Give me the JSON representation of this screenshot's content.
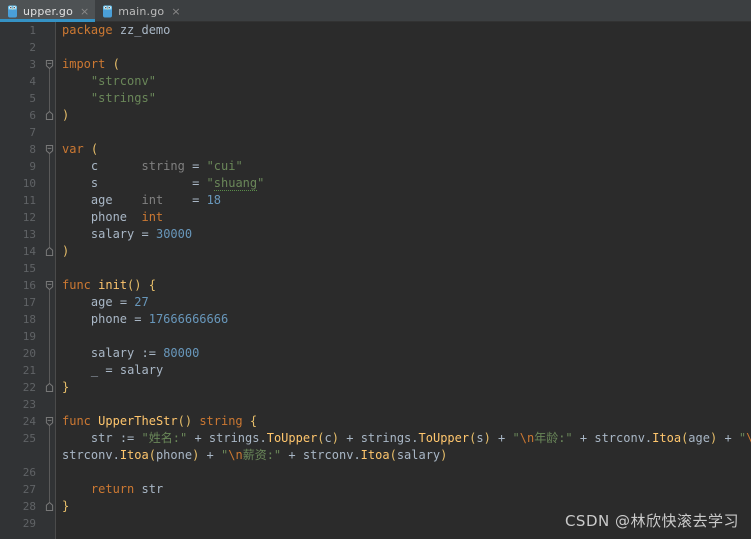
{
  "window": {
    "title": "upper.go",
    "editor_background": "#2b2b2b",
    "gutter_background": "#313335",
    "tabbar_background": "#3c3f41",
    "accent_color": "#3592c4"
  },
  "tabbar": {
    "tabs": [
      {
        "label": "upper.go",
        "icon": "go-gopher-icon",
        "close_glyph": "×",
        "active": true
      },
      {
        "label": "main.go",
        "icon": "go-gopher-icon",
        "close_glyph": "×",
        "active": false
      }
    ]
  },
  "editor": {
    "language": "go",
    "line_numbers": [
      "1",
      "2",
      "3",
      "4",
      "5",
      "6",
      "7",
      "8",
      "9",
      "10",
      "11",
      "12",
      "13",
      "14",
      "15",
      "16",
      "17",
      "18",
      "19",
      "20",
      "21",
      "22",
      "23",
      "24",
      "25",
      "26",
      "27",
      "28",
      "29"
    ],
    "code_lines": [
      {
        "n": 1,
        "text": "package zz_demo"
      },
      {
        "n": 2,
        "text": ""
      },
      {
        "n": 3,
        "text": "import ("
      },
      {
        "n": 4,
        "text": "    \"strconv\""
      },
      {
        "n": 5,
        "text": "    \"strings\""
      },
      {
        "n": 6,
        "text": ")"
      },
      {
        "n": 7,
        "text": ""
      },
      {
        "n": 8,
        "text": "var ("
      },
      {
        "n": 9,
        "text": "    c      string = \"cui\""
      },
      {
        "n": 10,
        "text": "    s             = \"shuang\""
      },
      {
        "n": 11,
        "text": "    age    int    = 18"
      },
      {
        "n": 12,
        "text": "    phone  int"
      },
      {
        "n": 13,
        "text": "    salary = 30000"
      },
      {
        "n": 14,
        "text": ")"
      },
      {
        "n": 15,
        "text": ""
      },
      {
        "n": 16,
        "text": "func init() {"
      },
      {
        "n": 17,
        "text": "    age = 27"
      },
      {
        "n": 18,
        "text": "    phone = 17666666666"
      },
      {
        "n": 19,
        "text": ""
      },
      {
        "n": 20,
        "text": "    salary := 80000"
      },
      {
        "n": 21,
        "text": "    _ = salary"
      },
      {
        "n": 22,
        "text": "}"
      },
      {
        "n": 23,
        "text": ""
      },
      {
        "n": 24,
        "text": "func UpperTheStr() string {"
      },
      {
        "n": 25,
        "text": "    str := \"姓名:\" + strings.ToUpper(c) + strings.ToUpper(s) + \"\\n年龄:\" + strconv.Itoa(age) + \"\\n手机号:\" + strconv.Itoa(phone) + \"\\n薪资:\" + strconv.Itoa(salary)"
      },
      {
        "n": 26,
        "text": ""
      },
      {
        "n": 27,
        "text": "    return str"
      },
      {
        "n": 28,
        "text": "}"
      },
      {
        "n": 29,
        "text": ""
      }
    ],
    "fold_markers": [
      {
        "line": 3,
        "state": "expanded"
      },
      {
        "line": 6,
        "state": "end"
      },
      {
        "line": 8,
        "state": "expanded"
      },
      {
        "line": 14,
        "state": "end"
      },
      {
        "line": 16,
        "state": "expanded"
      },
      {
        "line": 22,
        "state": "end"
      },
      {
        "line": 24,
        "state": "expanded"
      },
      {
        "line": 28,
        "state": "end"
      }
    ],
    "spellcheck_typos": [
      "shuang"
    ],
    "tokens": {
      "line1": {
        "keyword": "package",
        "package_name": "zz_demo"
      },
      "line3": {
        "keyword": "import",
        "paren": "("
      },
      "line4": {
        "string": "\"strconv\""
      },
      "line5": {
        "string": "\"strings\""
      },
      "line6": {
        "paren": ")"
      },
      "line8": {
        "keyword": "var",
        "paren": "("
      },
      "line9": {
        "name": "c",
        "type": "string",
        "eq": "=",
        "string": "\"cui\""
      },
      "line10": {
        "name": "s",
        "eq": "=",
        "string": "\"shuang\""
      },
      "line11": {
        "name": "age",
        "type": "int",
        "eq": "=",
        "number": "18"
      },
      "line12": {
        "name": "phone",
        "type": "int"
      },
      "line13": {
        "name": "salary",
        "eq": "=",
        "number": "30000"
      },
      "line14": {
        "paren": ")"
      },
      "line16": {
        "keyword": "func",
        "fname": "init",
        "parens": "()",
        "brace": "{"
      },
      "line17": {
        "name": "age",
        "eq": "=",
        "number": "27"
      },
      "line18": {
        "name": "phone",
        "eq": "=",
        "number": "17666666666"
      },
      "line20": {
        "name": "salary",
        "op": ":=",
        "number": "80000"
      },
      "line21": {
        "name": "_",
        "eq": "=",
        "value": "salary"
      },
      "line22": {
        "brace": "}"
      },
      "line24": {
        "keyword": "func",
        "fname": "UpperTheStr",
        "parens": "()",
        "ret": "string",
        "brace": "{"
      },
      "line25": {
        "name": "str",
        "op": ":=",
        "literals": [
          "\"姓名:\"",
          "\"\\n年龄:\"",
          "\"\\n手机号:\"",
          "\"\\n薪资:\""
        ],
        "calls": [
          "strings.ToUpper(c)",
          "strings.ToUpper(s)",
          "strconv.Itoa(age)",
          "strconv.Itoa(phone)",
          "strconv.Itoa(salary)"
        ]
      },
      "line27": {
        "keyword": "return",
        "value": "str"
      },
      "line28": {
        "brace": "}"
      }
    },
    "colors": {
      "keyword": "#cc7832",
      "string": "#6a8759",
      "number": "#6897bb",
      "function_name": "#ffc66d",
      "identifier": "#a9b7c6",
      "dim_type": "#808080",
      "brace": "#e8bf6a",
      "line_number": "#606366"
    }
  },
  "watermark": {
    "text": "CSDN @林欣快滚去学习"
  }
}
